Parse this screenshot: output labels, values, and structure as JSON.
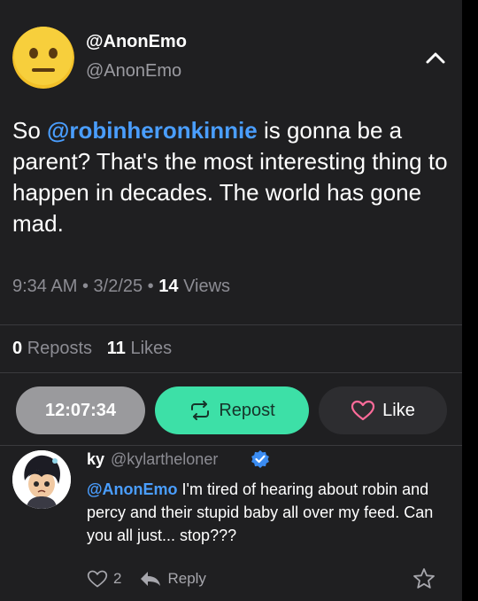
{
  "post": {
    "display_name": "@AnonEmo",
    "handle": "@AnonEmo",
    "text_prefix": "So ",
    "mention": "@robinheronkinnie",
    "text_suffix": " is gonna be a parent? That's the most interesting thing to happen in decades. The world has gone mad.",
    "time": "9:34 AM",
    "date": "3/2/25",
    "views_count": "14",
    "views_label": "Views",
    "reposts_count": "0",
    "reposts_label": "Reposts",
    "likes_count": "11",
    "likes_label": "Likes"
  },
  "actions": {
    "timer_label": "12:07:34",
    "repost_label": "Repost",
    "like_label": "Like"
  },
  "reply": {
    "display_name": "ky",
    "handle": "@kylartheloner",
    "mention": "@AnonEmo",
    "text": " I'm tired of hearing about robin and percy and their stupid baby all over my feed. Can you all just... stop???",
    "like_count": "2",
    "reply_label": "Reply"
  },
  "colors": {
    "background": "#1f1f21",
    "mention": "#4a9eff",
    "repost_button": "#3de0a7",
    "verified": "#3b8cf2",
    "like_heart": "#ff6b9a"
  },
  "icons": {
    "collapse": "chevron-up-icon",
    "repost": "repost-icon",
    "like": "heart-icon",
    "verified": "verified-badge-icon",
    "reply": "reply-arrow-icon",
    "bookmark": "star-icon"
  }
}
